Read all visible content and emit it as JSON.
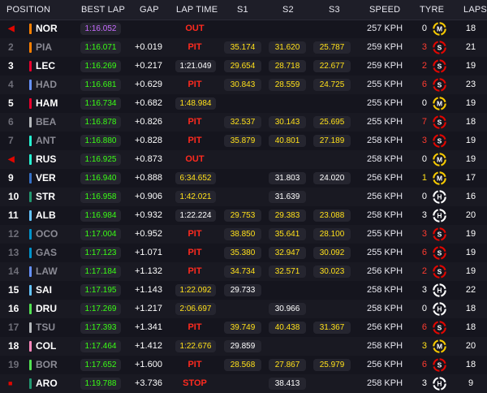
{
  "header": {
    "position": "POSITION",
    "best_lap": "BEST LAP",
    "gap": "GAP",
    "lap_time": "LAP TIME",
    "s1": "S1",
    "s2": "S2",
    "s3": "S3",
    "speed": "SPEED",
    "tyre": "TYRE",
    "laps": "LAPS"
  },
  "colors": {
    "purple": "#c76bff",
    "green": "#39ff14",
    "yellow": "#ffe01a",
    "red": "#ff2a1f",
    "soft": "#e10600",
    "medium": "#f5c800",
    "hard": "#ffffff"
  },
  "rows": [
    {
      "pos": "◀",
      "marker": true,
      "team": "#ff8000",
      "driver": "NOR",
      "best": "1:16.052",
      "best_purple": true,
      "gap": "",
      "laptime": "",
      "status": "OUT",
      "s1": "",
      "s2": "",
      "s3": "",
      "speed": "257 KPH",
      "stints": "0",
      "stint_color": "white",
      "tyre": "M",
      "tyre_icon": "medium-tyre-icon",
      "laps": "18"
    },
    {
      "pos": "2",
      "dim": true,
      "team": "#ff8000",
      "driver": "PIA",
      "best": "1:16.071",
      "gap": "+0.019",
      "laptime": "",
      "status": "PIT",
      "s1": "35.174",
      "s2": "31.620",
      "s3": "25.787",
      "speed": "259 KPH",
      "stints": "3",
      "stint_color": "red",
      "tyre": "S",
      "tyre_icon": "soft-tyre-icon",
      "laps": "21"
    },
    {
      "pos": "3",
      "team": "#e8002d",
      "driver": "LEC",
      "best": "1:16.269",
      "gap": "+0.217",
      "laptime": "1:21.049",
      "status": "",
      "s1": "29.654",
      "s2": "28.718",
      "s3": "22.677",
      "speed": "259 KPH",
      "stints": "2",
      "stint_color": "red",
      "tyre": "S",
      "tyre_icon": "soft-tyre-icon",
      "laps": "19"
    },
    {
      "pos": "4",
      "dim": true,
      "team": "#6692ff",
      "driver": "HAD",
      "best": "1:16.681",
      "gap": "+0.629",
      "laptime": "",
      "status": "PIT",
      "s1": "30.843",
      "s2": "28.559",
      "s3": "24.725",
      "speed": "255 KPH",
      "stints": "6",
      "stint_color": "red",
      "tyre": "S",
      "tyre_icon": "soft-tyre-icon",
      "laps": "23"
    },
    {
      "pos": "5",
      "team": "#e8002d",
      "driver": "HAM",
      "best": "1:16.734",
      "gap": "+0.682",
      "laptime": "1:48.984",
      "laptime_yellow": true,
      "status": "",
      "s1": "",
      "s2": "",
      "s3": "",
      "speed": "255 KPH",
      "stints": "0",
      "stint_color": "white",
      "tyre": "M",
      "tyre_icon": "medium-tyre-icon",
      "laps": "19"
    },
    {
      "pos": "6",
      "dim": true,
      "team": "#b6babd",
      "driver": "BEA",
      "best": "1:16.878",
      "gap": "+0.826",
      "laptime": "",
      "status": "PIT",
      "s1": "32.537",
      "s2": "30.143",
      "s3": "25.695",
      "speed": "255 KPH",
      "stints": "7",
      "stint_color": "red",
      "tyre": "S",
      "tyre_icon": "soft-tyre-icon",
      "laps": "18"
    },
    {
      "pos": "7",
      "dim": true,
      "team": "#27f4d2",
      "driver": "ANT",
      "best": "1:16.880",
      "gap": "+0.828",
      "laptime": "",
      "status": "PIT",
      "s1": "35.879",
      "s2": "40.801",
      "s3": "27.189",
      "speed": "258 KPH",
      "stints": "3",
      "stint_color": "red",
      "tyre": "S",
      "tyre_icon": "soft-tyre-icon",
      "laps": "19"
    },
    {
      "pos": "◀",
      "marker": true,
      "team": "#27f4d2",
      "driver": "RUS",
      "best": "1:16.925",
      "gap": "+0.873",
      "laptime": "",
      "status": "OUT",
      "s1": "",
      "s2": "",
      "s3": "",
      "speed": "258 KPH",
      "stints": "0",
      "stint_color": "white",
      "tyre": "M",
      "tyre_icon": "medium-tyre-icon",
      "laps": "19"
    },
    {
      "pos": "9",
      "team": "#3671c6",
      "driver": "VER",
      "best": "1:16.940",
      "gap": "+0.888",
      "laptime": "6:34.652",
      "laptime_yellow": true,
      "status": "",
      "s1": "",
      "s2": "31.803",
      "s3": "24.020",
      "s2_white": true,
      "s3_white": true,
      "speed": "256 KPH",
      "stints": "1",
      "stint_color": "yellow",
      "tyre": "M",
      "tyre_icon": "medium-tyre-icon",
      "laps": "17"
    },
    {
      "pos": "10",
      "team": "#229971",
      "driver": "STR",
      "best": "1:16.958",
      "gap": "+0.906",
      "laptime": "1:42.021",
      "laptime_yellow": true,
      "status": "",
      "s1": "",
      "s2": "31.639",
      "s3": "",
      "s2_white": true,
      "speed": "256 KPH",
      "stints": "0",
      "stint_color": "white",
      "tyre": "H",
      "tyre_icon": "hard-tyre-icon",
      "laps": "16"
    },
    {
      "pos": "11",
      "team": "#64c4ff",
      "driver": "ALB",
      "best": "1:16.984",
      "gap": "+0.932",
      "laptime": "1:22.224",
      "status": "",
      "s1": "29.753",
      "s2": "29.383",
      "s3": "23.088",
      "speed": "258 KPH",
      "stints": "3",
      "stint_color": "white",
      "tyre": "H",
      "tyre_icon": "hard-tyre-icon",
      "laps": "20"
    },
    {
      "pos": "12",
      "dim": true,
      "team": "#0093cc",
      "driver": "OCO",
      "best": "1:17.004",
      "gap": "+0.952",
      "laptime": "",
      "status": "PIT",
      "s1": "38.850",
      "s2": "35.641",
      "s3": "28.100",
      "speed": "255 KPH",
      "stints": "3",
      "stint_color": "red",
      "tyre": "S",
      "tyre_icon": "soft-tyre-icon",
      "laps": "19"
    },
    {
      "pos": "13",
      "dim": true,
      "team": "#0093cc",
      "driver": "GAS",
      "best": "1:17.123",
      "gap": "+1.071",
      "laptime": "",
      "status": "PIT",
      "s1": "35.380",
      "s2": "32.947",
      "s3": "30.092",
      "speed": "255 KPH",
      "stints": "6",
      "stint_color": "red",
      "tyre": "S",
      "tyre_icon": "soft-tyre-icon",
      "laps": "19"
    },
    {
      "pos": "14",
      "dim": true,
      "team": "#6692ff",
      "driver": "LAW",
      "best": "1:17.184",
      "gap": "+1.132",
      "laptime": "",
      "status": "PIT",
      "s1": "34.734",
      "s2": "32.571",
      "s3": "30.023",
      "speed": "256 KPH",
      "stints": "2",
      "stint_color": "red",
      "tyre": "S",
      "tyre_icon": "soft-tyre-icon",
      "laps": "19"
    },
    {
      "pos": "15",
      "team": "#64c4ff",
      "driver": "SAI",
      "best": "1:17.195",
      "gap": "+1.143",
      "laptime": "1:22.092",
      "laptime_yellow": true,
      "status": "",
      "s1": "29.733",
      "s2": "",
      "s3": "",
      "s1_white": true,
      "speed": "258 KPH",
      "stints": "3",
      "stint_color": "white",
      "tyre": "H",
      "tyre_icon": "hard-tyre-icon",
      "laps": "22"
    },
    {
      "pos": "16",
      "team": "#52e252",
      "driver": "DRU",
      "best": "1:17.269",
      "gap": "+1.217",
      "laptime": "2:06.697",
      "laptime_yellow": true,
      "status": "",
      "s1": "",
      "s2": "30.966",
      "s3": "",
      "s2_white": true,
      "speed": "258 KPH",
      "stints": "0",
      "stint_color": "white",
      "tyre": "H",
      "tyre_icon": "hard-tyre-icon",
      "laps": "18"
    },
    {
      "pos": "17",
      "dim": true,
      "team": "#b6babd",
      "driver": "TSU",
      "best": "1:17.393",
      "gap": "+1.341",
      "laptime": "",
      "status": "PIT",
      "s1": "39.749",
      "s2": "40.438",
      "s3": "31.367",
      "speed": "256 KPH",
      "stints": "6",
      "stint_color": "red",
      "tyre": "S",
      "tyre_icon": "soft-tyre-icon",
      "laps": "18"
    },
    {
      "pos": "18",
      "team": "#ff87bc",
      "driver": "COL",
      "best": "1:17.464",
      "gap": "+1.412",
      "laptime": "1:22.676",
      "laptime_yellow": true,
      "status": "",
      "s1": "29.859",
      "s2": "",
      "s3": "",
      "s1_white": true,
      "speed": "258 KPH",
      "stints": "3",
      "stint_color": "yellow",
      "tyre": "M",
      "tyre_icon": "medium-tyre-icon",
      "laps": "20"
    },
    {
      "pos": "19",
      "dim": true,
      "team": "#52e252",
      "driver": "BOR",
      "best": "1:17.652",
      "gap": "+1.600",
      "laptime": "",
      "status": "PIT",
      "s1": "28.568",
      "s2": "27.867",
      "s3": "25.979",
      "speed": "256 KPH",
      "stints": "6",
      "stint_color": "red",
      "tyre": "S",
      "tyre_icon": "soft-tyre-icon",
      "laps": "18"
    },
    {
      "pos": "■",
      "marker": true,
      "square": true,
      "team": "#229971",
      "driver": "ARO",
      "best": "1:19.788",
      "gap": "+3.736",
      "laptime": "",
      "status": "STOP",
      "s1": "",
      "s2": "38.413",
      "s3": "",
      "s2_white": true,
      "speed": "258 KPH",
      "stints": "3",
      "stint_color": "white",
      "tyre": "H",
      "tyre_icon": "hard-tyre-icon",
      "laps": "9"
    }
  ]
}
